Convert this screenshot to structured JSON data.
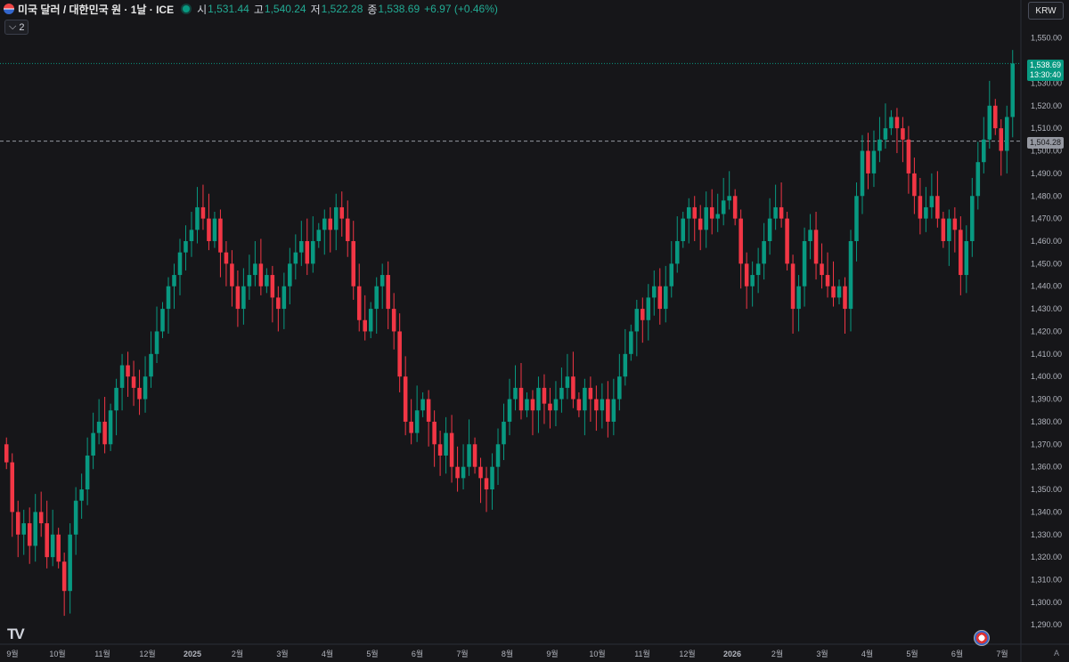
{
  "header": {
    "symbol": "미국 달러 / 대한민국 원 · 1날 · ICE",
    "open_label": "시",
    "open": "1,531.44",
    "high_label": "고",
    "high": "1,540.24",
    "low_label": "저",
    "low": "1,522.28",
    "close_label": "종",
    "close": "1,538.69",
    "change": "+6.97 (+0.46%)"
  },
  "indicator_count": "2",
  "currency_button": "KRW",
  "auto_label": "A",
  "last_price_tag": {
    "price": "1,538.69",
    "time": "13:30:40"
  },
  "ref_price_tag": "1,504.28",
  "colors": {
    "up": "#089981",
    "down": "#f23645",
    "background": "#161619",
    "text": "#d1d4dc"
  },
  "icons": {
    "logo": "tradingview-logo-icon",
    "event": "us-flag-event-icon"
  },
  "chart_data": {
    "type": "candlestick",
    "ylim": [
      1283,
      1555
    ],
    "yticks": [
      1290,
      1300,
      1310,
      1320,
      1330,
      1340,
      1350,
      1360,
      1370,
      1380,
      1390,
      1400,
      1410,
      1420,
      1430,
      1440,
      1450,
      1460,
      1470,
      1480,
      1490,
      1500,
      1510,
      1520,
      1530,
      1550
    ],
    "x_months": [
      "9월",
      "10월",
      "11월",
      "12월",
      "2025",
      "2월",
      "3월",
      "4월",
      "5월",
      "6월",
      "7월",
      "8월",
      "9월",
      "10월",
      "11월",
      "12월",
      "2026",
      "2월",
      "3월",
      "4월",
      "5월",
      "6월",
      "7월"
    ],
    "last_price": 1538.69,
    "reference_price": 1504.28,
    "closes": [
      1362,
      1340,
      1330,
      1335,
      1325,
      1340,
      1335,
      1320,
      1330,
      1318,
      1305,
      1330,
      1345,
      1350,
      1365,
      1375,
      1380,
      1370,
      1385,
      1395,
      1405,
      1400,
      1395,
      1390,
      1400,
      1410,
      1420,
      1430,
      1440,
      1445,
      1455,
      1460,
      1465,
      1475,
      1470,
      1460,
      1470,
      1455,
      1450,
      1440,
      1430,
      1440,
      1445,
      1450,
      1440,
      1445,
      1435,
      1430,
      1440,
      1450,
      1455,
      1460,
      1450,
      1460,
      1465,
      1470,
      1465,
      1475,
      1470,
      1460,
      1440,
      1425,
      1420,
      1430,
      1440,
      1445,
      1430,
      1420,
      1400,
      1380,
      1375,
      1385,
      1390,
      1380,
      1370,
      1365,
      1375,
      1360,
      1355,
      1360,
      1370,
      1360,
      1355,
      1350,
      1360,
      1370,
      1380,
      1390,
      1395,
      1385,
      1390,
      1385,
      1395,
      1388,
      1385,
      1390,
      1395,
      1400,
      1390,
      1385,
      1395,
      1390,
      1385,
      1390,
      1380,
      1390,
      1400,
      1410,
      1420,
      1430,
      1425,
      1435,
      1440,
      1430,
      1440,
      1450,
      1460,
      1470,
      1475,
      1470,
      1465,
      1475,
      1470,
      1472,
      1478,
      1480,
      1470,
      1450,
      1440,
      1445,
      1450,
      1460,
      1470,
      1475,
      1470,
      1450,
      1430,
      1440,
      1460,
      1465,
      1450,
      1445,
      1440,
      1435,
      1440,
      1430,
      1460,
      1480,
      1500,
      1490,
      1500,
      1505,
      1510,
      1515,
      1510,
      1505,
      1490,
      1480,
      1470,
      1475,
      1480,
      1470,
      1460,
      1470,
      1465,
      1445,
      1460,
      1480,
      1495,
      1505,
      1520,
      1510,
      1500,
      1515,
      1538.69
    ],
    "series_name": "USD/KRW"
  }
}
